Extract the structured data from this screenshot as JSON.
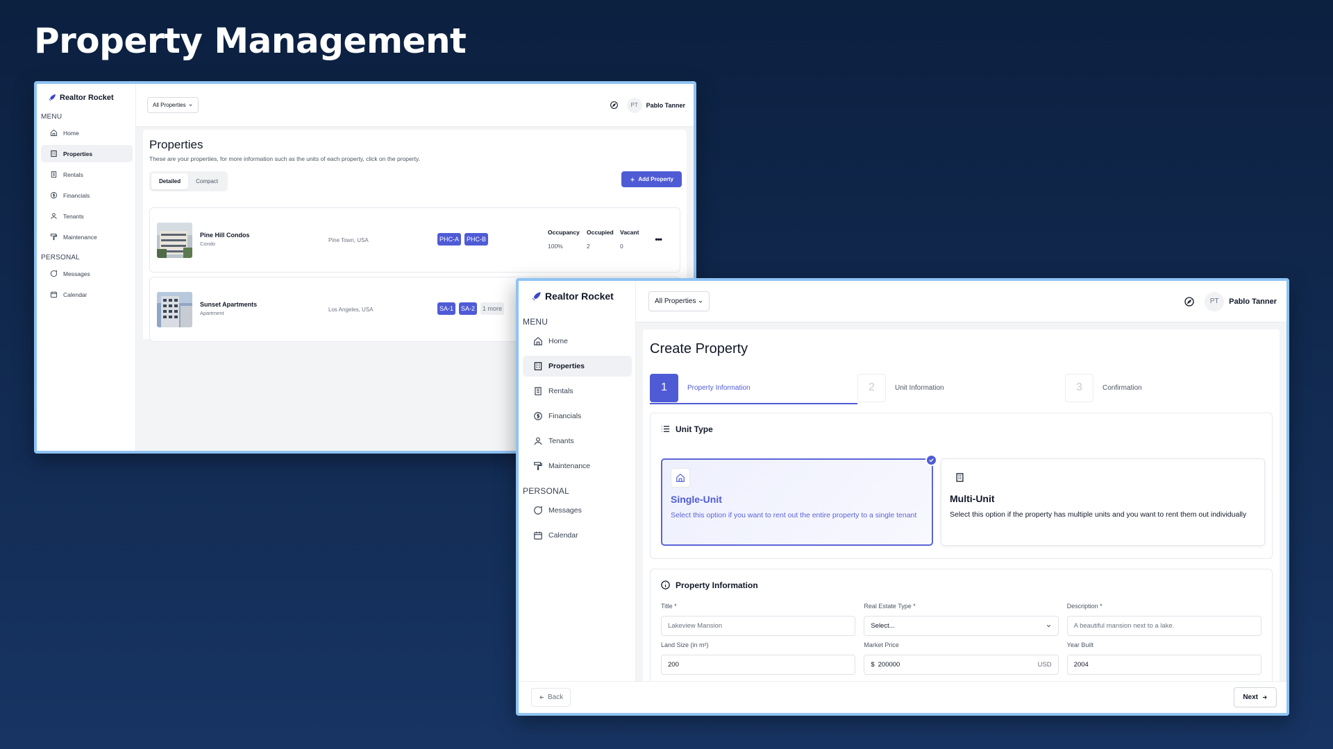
{
  "hero": {
    "title": "Property Management"
  },
  "app": {
    "brand": "Realtor Rocket",
    "menu_label": "MENU",
    "personal_label": "PERSONAL",
    "menu_items": [
      {
        "label": "Home",
        "icon": "home-icon"
      },
      {
        "label": "Properties",
        "icon": "building-icon"
      },
      {
        "label": "Rentals",
        "icon": "rentals-icon"
      },
      {
        "label": "Financials",
        "icon": "dollar-icon"
      },
      {
        "label": "Tenants",
        "icon": "user-icon"
      },
      {
        "label": "Maintenance",
        "icon": "paint-roller-icon"
      }
    ],
    "personal_items": [
      {
        "label": "Messages",
        "icon": "message-icon"
      },
      {
        "label": "Calendar",
        "icon": "calendar-icon"
      }
    ],
    "property_filter": "All Properties",
    "user": {
      "initials": "PT",
      "name": "Pablo Tanner"
    }
  },
  "properties_page": {
    "title": "Properties",
    "subtitle": "These are your properties, for more information such as the units of each property, click on the property.",
    "view_tabs": [
      "Detailed",
      "Compact"
    ],
    "add_button": "Add Property",
    "stat_headers": [
      "Occupancy",
      "Occupied",
      "Vacant"
    ],
    "properties": [
      {
        "name": "Pine Hill Condos",
        "type": "Condo",
        "location": "Pine Town, USA",
        "tags": [
          "PHC-A",
          "PHC-B"
        ],
        "occupancy": "100%",
        "occupied": "2",
        "vacant": "0"
      },
      {
        "name": "Sunset Apartments",
        "type": "Apartment",
        "location": "Los Angeles, USA",
        "tags": [
          "SA-1",
          "SA-2"
        ],
        "more": "1 more"
      }
    ]
  },
  "create_page": {
    "title": "Create Property",
    "steps": [
      {
        "num": "1",
        "label": "Property Information"
      },
      {
        "num": "2",
        "label": "Unit Information"
      },
      {
        "num": "3",
        "label": "Confirmation"
      }
    ],
    "unit_type": {
      "title": "Unit Type",
      "options": [
        {
          "title": "Single-Unit",
          "desc": "Select this option if you want to rent out the entire property to a single tenant"
        },
        {
          "title": "Multi-Unit",
          "desc": "Select this option if the property has multiple units and you want to rent them out individually"
        }
      ]
    },
    "property_info": {
      "title": "Property Information",
      "fields": [
        {
          "label": "Title *",
          "value": "Lakeview Mansion"
        },
        {
          "label": "Real Estate Type *",
          "value": "Select..."
        },
        {
          "label": "Description *",
          "value": "A beautiful mansion next to a lake."
        },
        {
          "label": "Land Size (in m²)",
          "value": "200"
        },
        {
          "label": "Market Price",
          "prefix": "$",
          "value": "200000",
          "suffix": "USD"
        },
        {
          "label": "Year Built",
          "value": "2004"
        }
      ]
    },
    "back_button": "Back",
    "next_button": "Next"
  },
  "colors": {
    "accent": "#4f5bd5",
    "background": "#0c2040",
    "window_border": "#8fc3f3"
  }
}
